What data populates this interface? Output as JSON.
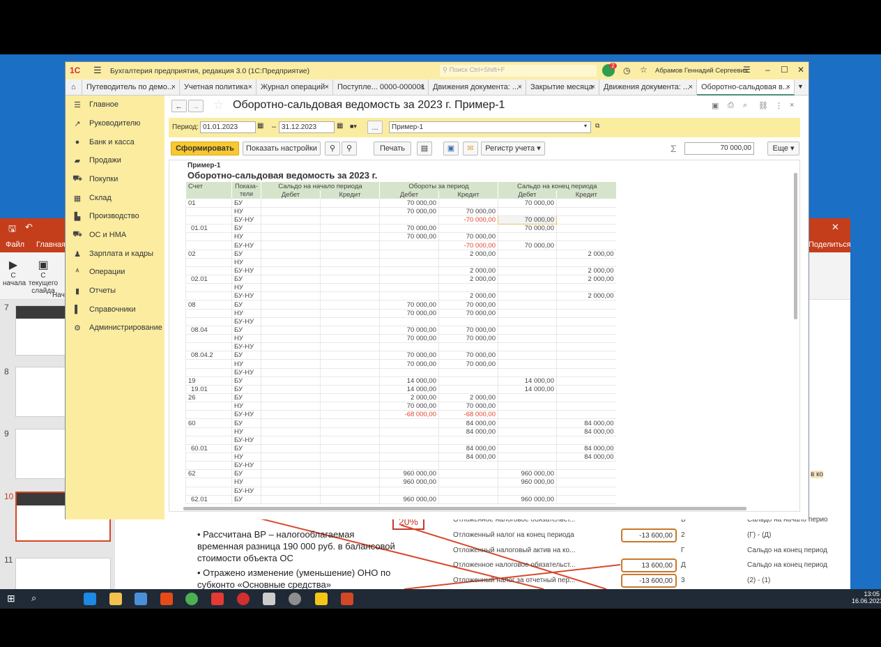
{
  "app": {
    "title": "Бухгалтерия предприятия, редакция 3.0  (1С:Предприятие)",
    "search_placeholder": "Поиск Ctrl+Shift+F",
    "notifications": "2",
    "user": "Абрамов Геннадий Сергеевич"
  },
  "tabs": [
    {
      "label": "Путеводитель по демо..."
    },
    {
      "label": "Учетная политика"
    },
    {
      "label": "Журнал операций"
    },
    {
      "label": "Поступле... 0000-000001"
    },
    {
      "label": "Движения документа: ..."
    },
    {
      "label": "Закрытие месяца"
    },
    {
      "label": "Движения документа: ..."
    },
    {
      "label": "Оборотно-сальдовая в..."
    }
  ],
  "sidebar": [
    "Главное",
    "Руководителю",
    "Банк и касса",
    "Продажи",
    "Покупки",
    "Склад",
    "Производство",
    "ОС и НМА",
    "Зарплата и кадры",
    "Операции",
    "Отчеты",
    "Справочники",
    "Администрирование"
  ],
  "form": {
    "title": "Оборотно-сальдовая ведомость за 2023 г. Пример-1",
    "period_label": "Период:",
    "date_from": "01.01.2023",
    "dash": "–",
    "date_to": "31.12.2023",
    "dots": "...",
    "settings": "Пример-1",
    "generate": "Сформировать",
    "show_settings": "Показать настройки",
    "print": "Печать",
    "register": "Регистр учета ▾",
    "sum_symbol": "Σ",
    "sum": "70 000,00",
    "more": "Еще ▾"
  },
  "report": {
    "caption": "Пример-1",
    "title": "Оборотно-сальдовая ведомость за 2023 г.",
    "headers": {
      "account": "Счет",
      "indicator": "Показа-тели",
      "opening": "Сальдо на начало периода",
      "turnover": "Обороты за период",
      "closing": "Сальдо на конец периода",
      "debit": "Дебет",
      "credit": "Кредит"
    },
    "rows": [
      [
        "01",
        "БУ",
        "",
        "",
        "70 000,00",
        "",
        "70 000,00",
        ""
      ],
      [
        "",
        "НУ",
        "",
        "",
        "70 000,00",
        "70 000,00",
        "",
        ""
      ],
      [
        "",
        "БУ-НУ",
        "",
        "",
        "",
        "-70 000,00",
        "70 000,00",
        ""
      ],
      [
        "01.01",
        "БУ",
        "",
        "",
        "70 000,00",
        "",
        "70 000,00",
        ""
      ],
      [
        "",
        "НУ",
        "",
        "",
        "70 000,00",
        "70 000,00",
        "",
        ""
      ],
      [
        "",
        "БУ-НУ",
        "",
        "",
        "",
        "-70 000,00",
        "70 000,00",
        ""
      ],
      [
        "02",
        "БУ",
        "",
        "",
        "",
        "2 000,00",
        "",
        "2 000,00"
      ],
      [
        "",
        "НУ",
        "",
        "",
        "",
        "",
        "",
        ""
      ],
      [
        "",
        "БУ-НУ",
        "",
        "",
        "",
        "2 000,00",
        "",
        "2 000,00"
      ],
      [
        "02.01",
        "БУ",
        "",
        "",
        "",
        "2 000,00",
        "",
        "2 000,00"
      ],
      [
        "",
        "НУ",
        "",
        "",
        "",
        "",
        "",
        ""
      ],
      [
        "",
        "БУ-НУ",
        "",
        "",
        "",
        "2 000,00",
        "",
        "2 000,00"
      ],
      [
        "08",
        "БУ",
        "",
        "",
        "70 000,00",
        "70 000,00",
        "",
        ""
      ],
      [
        "",
        "НУ",
        "",
        "",
        "70 000,00",
        "70 000,00",
        "",
        ""
      ],
      [
        "",
        "БУ-НУ",
        "",
        "",
        "",
        "",
        "",
        ""
      ],
      [
        "08.04",
        "БУ",
        "",
        "",
        "70 000,00",
        "70 000,00",
        "",
        ""
      ],
      [
        "",
        "НУ",
        "",
        "",
        "70 000,00",
        "70 000,00",
        "",
        ""
      ],
      [
        "",
        "БУ-НУ",
        "",
        "",
        "",
        "",
        "",
        ""
      ],
      [
        "08.04.2",
        "БУ",
        "",
        "",
        "70 000,00",
        "70 000,00",
        "",
        ""
      ],
      [
        "",
        "НУ",
        "",
        "",
        "70 000,00",
        "70 000,00",
        "",
        ""
      ],
      [
        "",
        "БУ-НУ",
        "",
        "",
        "",
        "",
        "",
        ""
      ],
      [
        "19",
        "БУ",
        "",
        "",
        "14 000,00",
        "",
        "14 000,00",
        ""
      ],
      [
        "19.01",
        "БУ",
        "",
        "",
        "14 000,00",
        "",
        "14 000,00",
        ""
      ],
      [
        "26",
        "БУ",
        "",
        "",
        "2 000,00",
        "2 000,00",
        "",
        ""
      ],
      [
        "",
        "НУ",
        "",
        "",
        "70 000,00",
        "70 000,00",
        "",
        ""
      ],
      [
        "",
        "БУ-НУ",
        "",
        "",
        "-68 000,00",
        "-68 000,00",
        "",
        ""
      ],
      [
        "60",
        "БУ",
        "",
        "",
        "",
        "84 000,00",
        "",
        "84 000,00"
      ],
      [
        "",
        "НУ",
        "",
        "",
        "",
        "84 000,00",
        "",
        "84 000,00"
      ],
      [
        "",
        "БУ-НУ",
        "",
        "",
        "",
        "",
        "",
        ""
      ],
      [
        "60.01",
        "БУ",
        "",
        "",
        "",
        "84 000,00",
        "",
        "84 000,00"
      ],
      [
        "",
        "НУ",
        "",
        "",
        "",
        "84 000,00",
        "",
        "84 000,00"
      ],
      [
        "",
        "БУ-НУ",
        "",
        "",
        "",
        "",
        "",
        ""
      ],
      [
        "62",
        "БУ",
        "",
        "",
        "960 000,00",
        "",
        "960 000,00",
        ""
      ],
      [
        "",
        "НУ",
        "",
        "",
        "960 000,00",
        "",
        "960 000,00",
        ""
      ],
      [
        "",
        "БУ-НУ",
        "",
        "",
        "",
        "",
        "",
        ""
      ],
      [
        "62.01",
        "БУ",
        "",
        "",
        "960 000,00",
        "",
        "960 000,00",
        ""
      ]
    ]
  },
  "ppt": {
    "file": "Файл",
    "home": "Главная",
    "from_start": "С начала",
    "from_current": "С текущего слайда",
    "group": "Начало",
    "share": "Поделиться",
    "slide_nums": [
      "7",
      "8",
      "9",
      "10",
      "11"
    ],
    "bullets": [
      "Рассчитана ВР – налогооблагаемая временная разница 190 000 руб. в балансовой стоимости объекта ОС",
      "Отражено изменение (уменьшение) ОНО по субконто «Основные средства»"
    ],
    "percent": "20%",
    "rows": [
      {
        "label": "Отложенное налоговое обязательст...",
        "value": "",
        "letter": "В",
        "desc": "Сальдо на начало перио"
      },
      {
        "label": "Отложенный налог на конец периода",
        "value": "-13 600,00",
        "letter": "2",
        "desc": "(Г) - (Д)"
      },
      {
        "label": "Отложенный налоговый актив на ко...",
        "value": "",
        "letter": "Г",
        "desc": "Сальдо на конец период"
      },
      {
        "label": "Отложенное налоговое обязательст...",
        "value": "13 600,00",
        "letter": "Д",
        "desc": "Сальдо на конец период"
      },
      {
        "label": "Отложенный налог за отчетный пер...",
        "value": "-13 600,00",
        "letter": "3",
        "desc": "(2) - (1)"
      }
    ],
    "right_text": "в ко"
  },
  "clock": {
    "time": "13:05",
    "date": "16.06.2023"
  }
}
